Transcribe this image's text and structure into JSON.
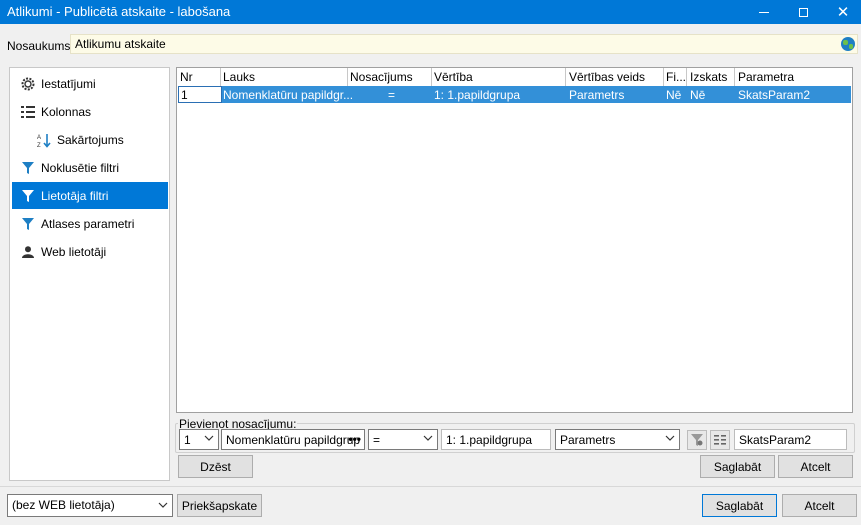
{
  "window": {
    "title": "Atlikumi - Publicētā atskaite - labošana",
    "minimize": "minimize",
    "maximize": "maximize",
    "close_glyph": "✕"
  },
  "name_field": {
    "label": "Nosaukums:",
    "value": "Atlikumu atskaite",
    "icon": "globe-icon"
  },
  "sidebar": {
    "items": [
      {
        "label": "Iestatījumi",
        "icon": "settings-icon"
      },
      {
        "label": "Kolonnas",
        "icon": "columns-icon"
      },
      {
        "label": "Sakārtojums",
        "icon": "sort-icon"
      },
      {
        "label": "Noklusētie filtri",
        "icon": "filter-icon"
      },
      {
        "label": "Lietotāja filtri",
        "icon": "filter-icon",
        "active": true
      },
      {
        "label": "Atlases parametri",
        "icon": "filter-icon"
      },
      {
        "label": "Web lietotāji",
        "icon": "user-icon"
      }
    ]
  },
  "grid": {
    "columns": [
      "Nr",
      "Lauks",
      "Nosacījums",
      "Vērtība",
      "Vērtības veids",
      "Fi...",
      "Izskats",
      "Parametra nosaukums"
    ],
    "rows": [
      {
        "nr": "1",
        "lauks": "Nomenklatūru papildgr...",
        "nosacijums": "=",
        "vertiba": "1: 1.papildgrupa",
        "veids": "Parametrs",
        "fi": "Nē",
        "izskats": "Nē",
        "param": "SkatsParam2"
      }
    ]
  },
  "add_condition": {
    "legend": "Pievienot nosacījumu:",
    "nr": "1",
    "field": "Nomenklatūru papildgrup",
    "field_more": "•••",
    "operator": "=",
    "value": "1: 1.papildgrupa",
    "value_type": "Parametrs",
    "param_name": "SkatsParam2"
  },
  "buttons": {
    "delete": "Dzēst",
    "inner_save": "Saglabāt",
    "inner_cancel": "Atcelt",
    "preview": "Priekšapskate",
    "save": "Saglabāt",
    "cancel": "Atcelt"
  },
  "web_user_select": "(bez WEB lietotāja)",
  "colors": {
    "titlebar": "#0078d7",
    "selection": "#3390d8",
    "name_field_bg": "#fdfbe7"
  }
}
